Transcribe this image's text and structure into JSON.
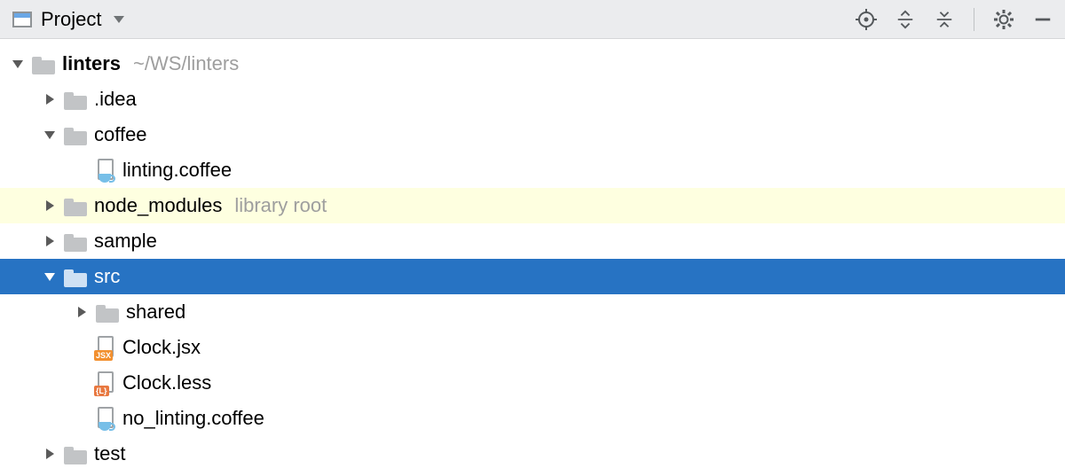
{
  "header": {
    "title": "Project",
    "icons": {
      "target": "target-icon",
      "expand_all": "expand-all-icon",
      "collapse_all": "collapse-all-icon",
      "settings": "gear-icon",
      "minimize": "minimize-icon"
    }
  },
  "tree": [
    {
      "depth": 0,
      "arrow": "down",
      "icon": "folder",
      "label": "linters",
      "hint": "~/WS/linters",
      "bold": true
    },
    {
      "depth": 1,
      "arrow": "right",
      "icon": "folder",
      "label": ".idea"
    },
    {
      "depth": 1,
      "arrow": "down",
      "icon": "folder",
      "label": "coffee"
    },
    {
      "depth": 2,
      "arrow": "none",
      "icon": "coffee",
      "label": "linting.coffee"
    },
    {
      "depth": 1,
      "arrow": "right",
      "icon": "folder",
      "label": "node_modules",
      "hint": "library root",
      "library": true
    },
    {
      "depth": 1,
      "arrow": "right",
      "icon": "folder",
      "label": "sample"
    },
    {
      "depth": 1,
      "arrow": "down",
      "icon": "folder",
      "label": "src",
      "selected": true
    },
    {
      "depth": 2,
      "arrow": "right",
      "icon": "folder",
      "label": "shared"
    },
    {
      "depth": 2,
      "arrow": "none",
      "icon": "jsx",
      "label": "Clock.jsx"
    },
    {
      "depth": 2,
      "arrow": "none",
      "icon": "less",
      "label": "Clock.less"
    },
    {
      "depth": 2,
      "arrow": "none",
      "icon": "coffee",
      "label": "no_linting.coffee"
    },
    {
      "depth": 1,
      "arrow": "right",
      "icon": "folder",
      "label": "test"
    }
  ]
}
